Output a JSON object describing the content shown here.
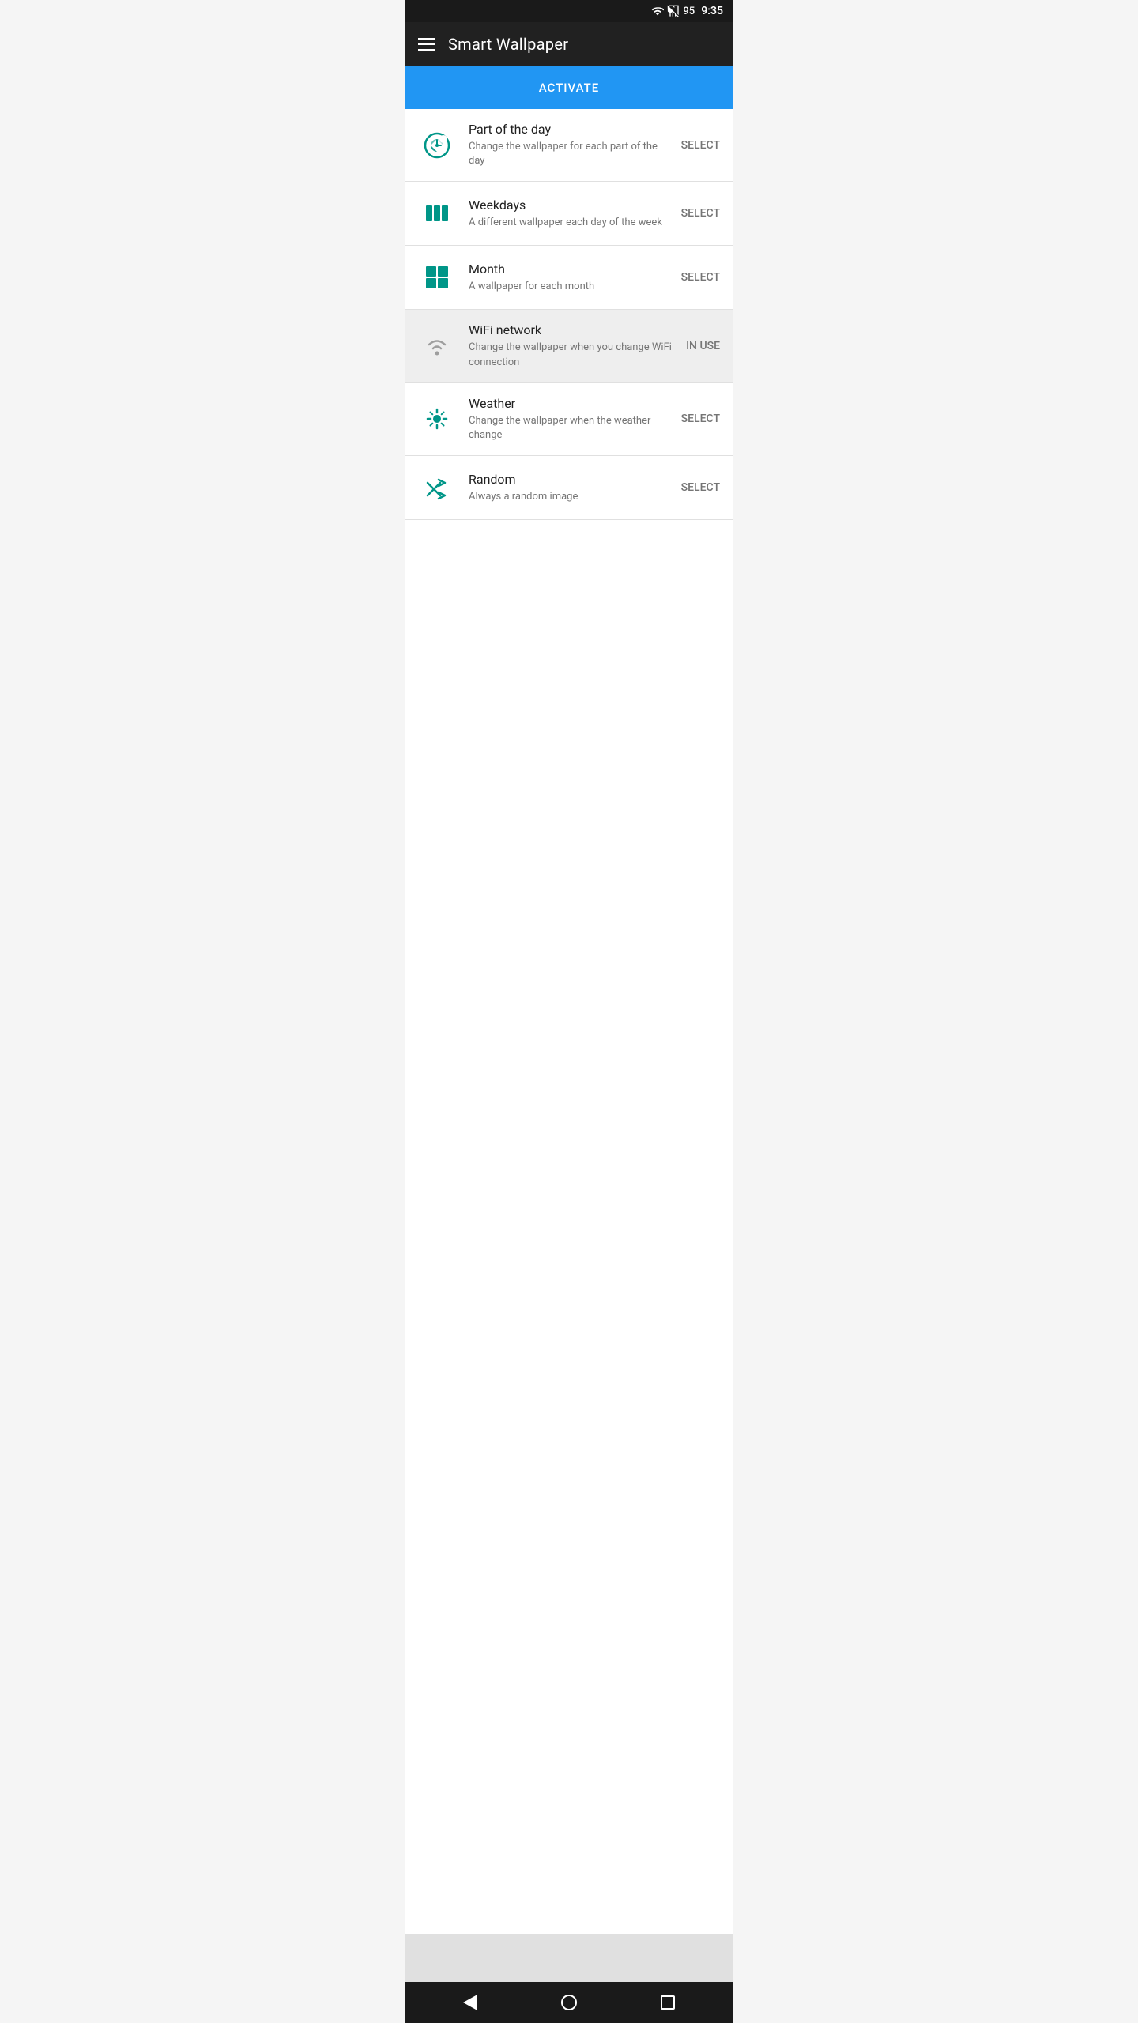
{
  "statusBar": {
    "battery": "95",
    "time": "9:35"
  },
  "appBar": {
    "title": "Smart Wallpaper",
    "menuIcon": "menu-icon"
  },
  "activateButton": {
    "label": "ACTIVATE"
  },
  "listItems": [
    {
      "id": "part-of-day",
      "icon": "clock-icon",
      "title": "Part of the day",
      "description": "Change the wallpaper for each part of the day",
      "action": "SELECT",
      "inUse": false
    },
    {
      "id": "weekdays",
      "icon": "weekdays-icon",
      "title": "Weekdays",
      "description": "A different wallpaper each day of the week",
      "action": "SELECT",
      "inUse": false
    },
    {
      "id": "month",
      "icon": "month-icon",
      "title": "Month",
      "description": "A wallpaper for each month",
      "action": "SELECT",
      "inUse": false
    },
    {
      "id": "wifi-network",
      "icon": "wifi-icon",
      "title": "WiFi network",
      "description": "Change the wallpaper when you change WiFi connection",
      "action": "IN USE",
      "inUse": true
    },
    {
      "id": "weather",
      "icon": "weather-icon",
      "title": "Weather",
      "description": "Change the wallpaper when the weather change",
      "action": "SELECT",
      "inUse": false
    },
    {
      "id": "random",
      "icon": "random-icon",
      "title": "Random",
      "description": "Always a random image",
      "action": "SELECT",
      "inUse": false
    }
  ],
  "colors": {
    "teal": "#009688",
    "blue": "#2196F3",
    "darkBg": "#212121",
    "statusBg": "#1a1a1a",
    "inUseBg": "#eeeeee",
    "divider": "#e0e0e0",
    "textPrimary": "#212121",
    "textSecondary": "#757575"
  }
}
